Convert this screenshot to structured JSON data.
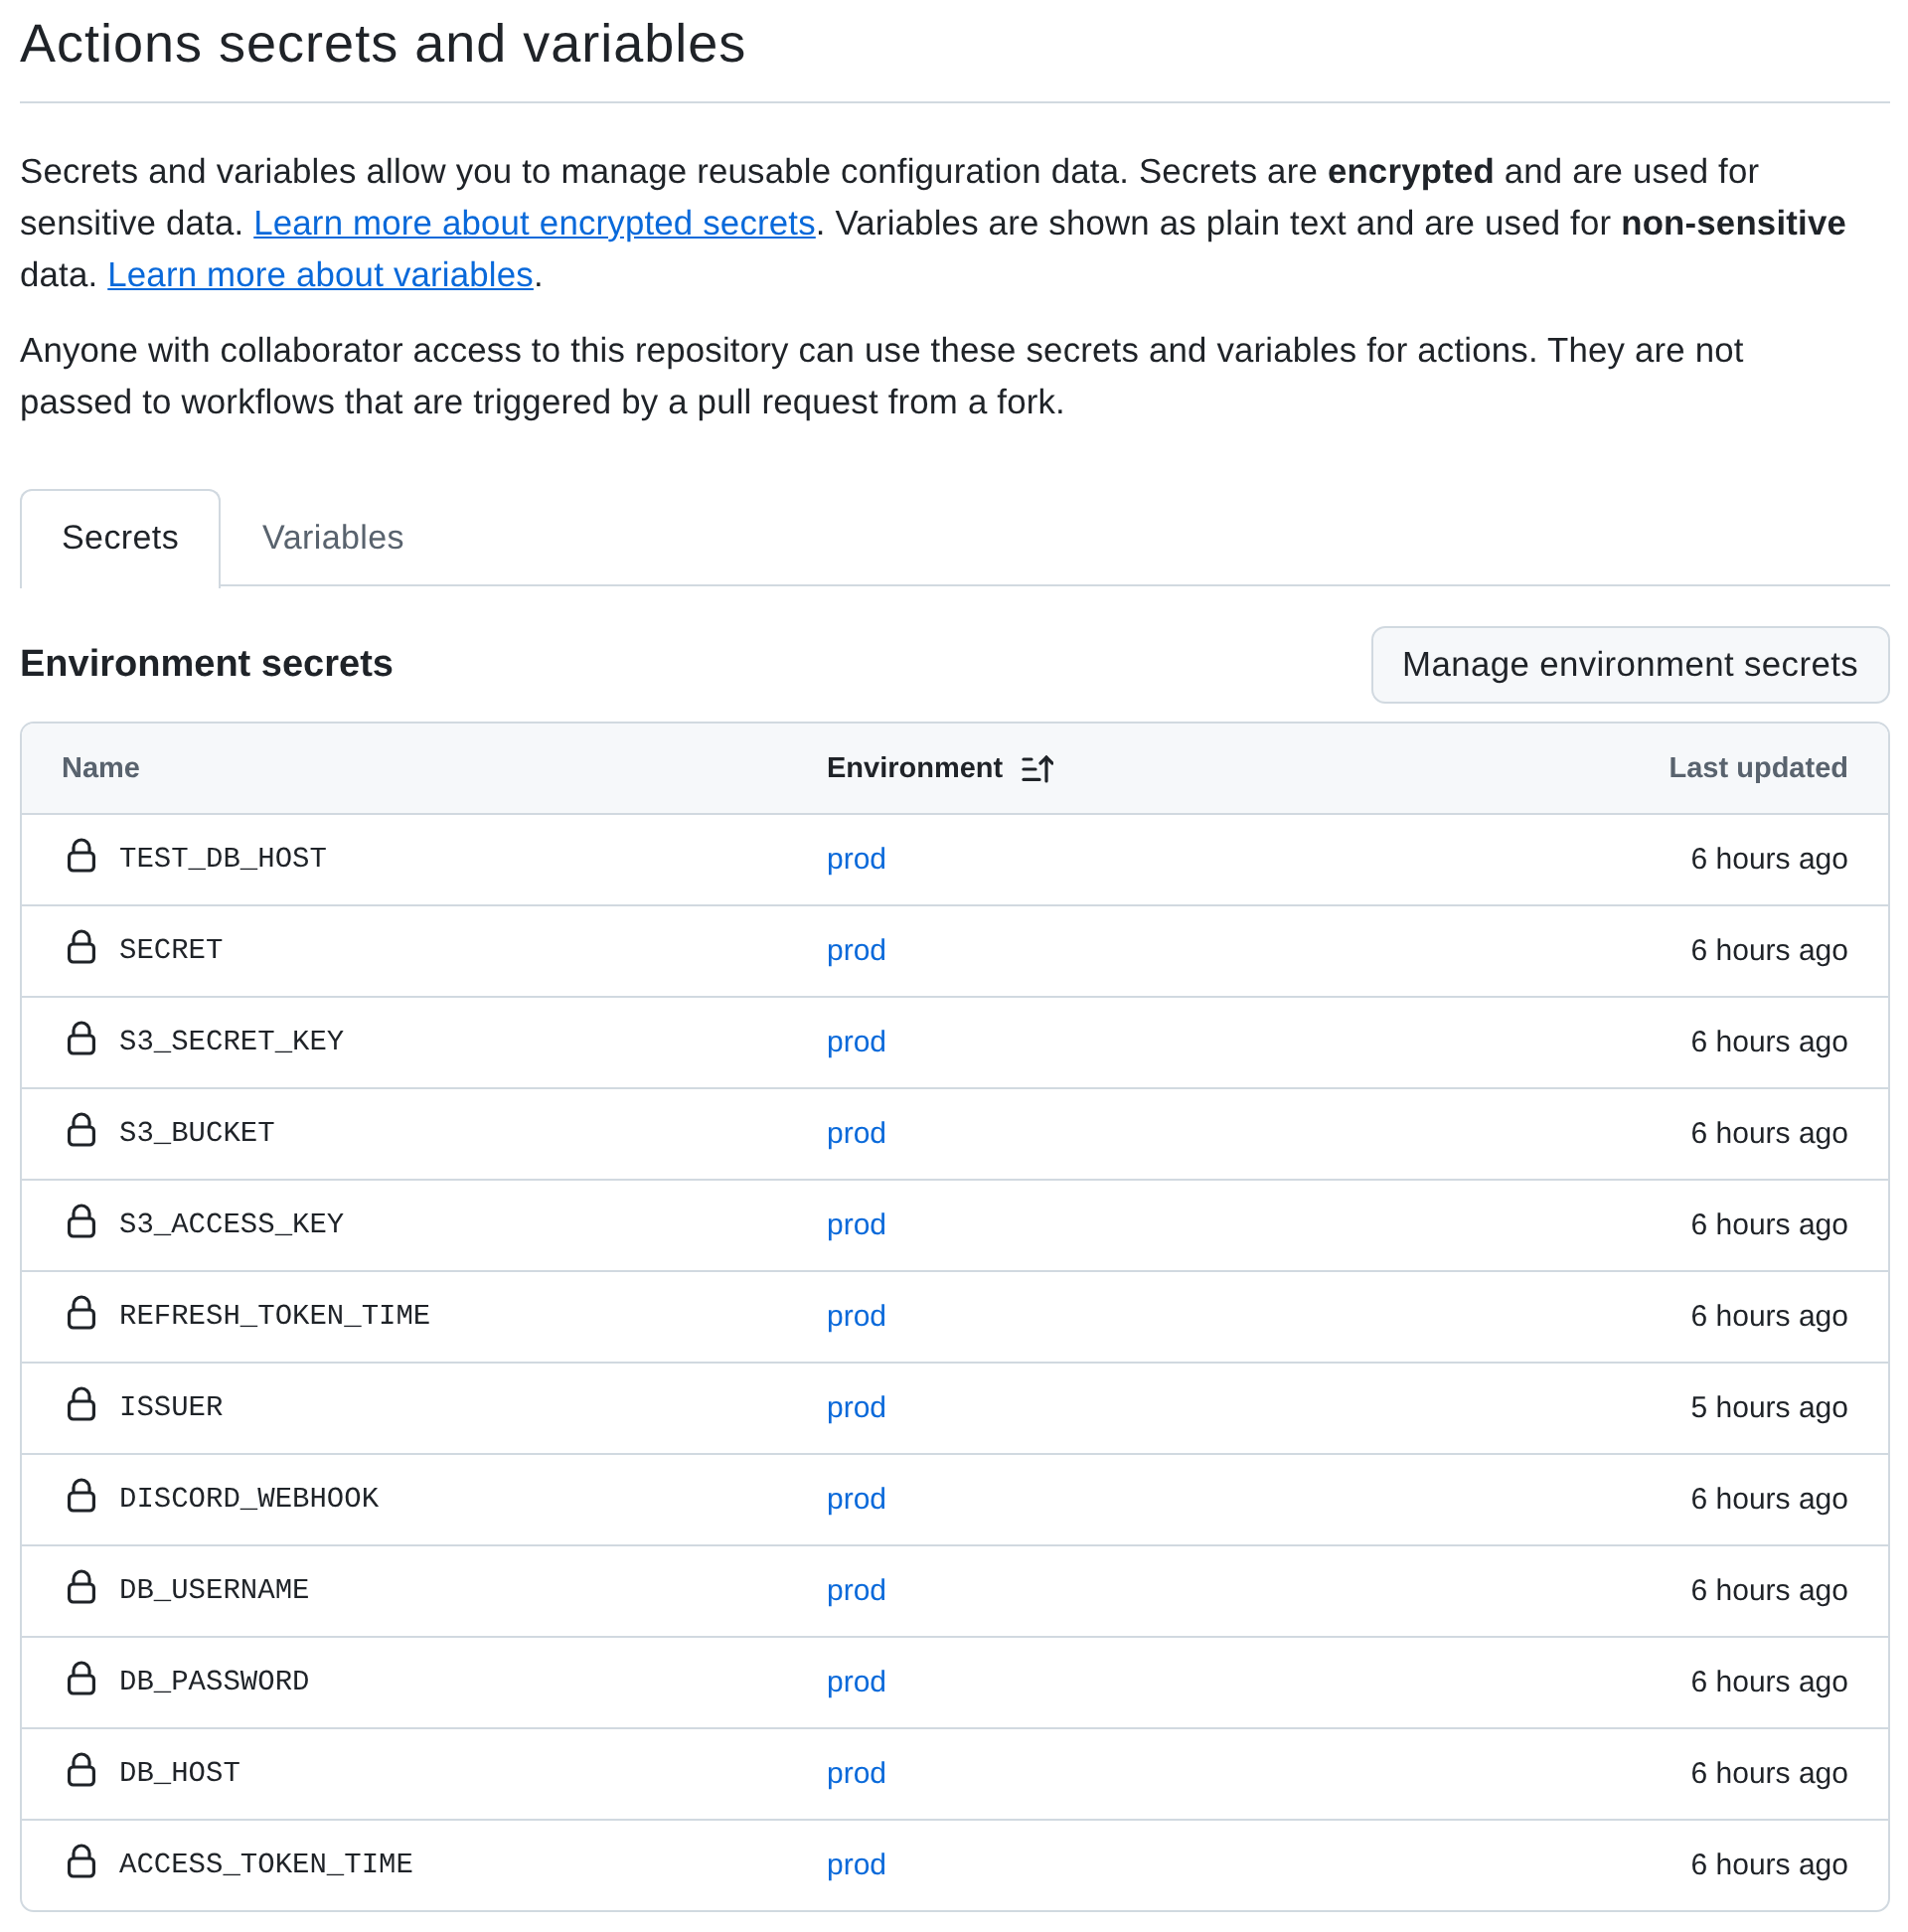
{
  "page": {
    "title": "Actions secrets and variables"
  },
  "description": [
    {
      "parts": [
        {
          "kind": "text",
          "text": "Secrets and variables allow you to manage reusable configuration data. Secrets are **encrypted** and are used for sensitive data. "
        },
        {
          "kind": "link",
          "text": "Learn more about encrypted secrets"
        },
        {
          "kind": "text",
          "text": ". Variables are shown as plain text and are used for **non-sensitive** data. "
        },
        {
          "kind": "link",
          "text": "Learn more about variables"
        },
        {
          "kind": "text",
          "text": "."
        }
      ]
    },
    {
      "parts": [
        {
          "kind": "text",
          "text": "Anyone with collaborator access to this repository can use these secrets and variables for actions. They are not passed to workflows that are triggered by a pull request from a fork."
        }
      ]
    }
  ],
  "tabs": [
    {
      "label": "Secrets",
      "selected": true
    },
    {
      "label": "Variables",
      "selected": false
    }
  ],
  "section": {
    "title": "Environment secrets",
    "button": "Manage environment secrets"
  },
  "table": {
    "columns": [
      {
        "label": "Name",
        "sorted": false
      },
      {
        "label": "Environment",
        "sorted": true
      },
      {
        "label": "Last updated",
        "sorted": false
      }
    ],
    "rows": [
      {
        "name": "TEST_DB_HOST",
        "environment": "prod",
        "updated": "6 hours ago"
      },
      {
        "name": "SECRET",
        "environment": "prod",
        "updated": "6 hours ago"
      },
      {
        "name": "S3_SECRET_KEY",
        "environment": "prod",
        "updated": "6 hours ago"
      },
      {
        "name": "S3_BUCKET",
        "environment": "prod",
        "updated": "6 hours ago"
      },
      {
        "name": "S3_ACCESS_KEY",
        "environment": "prod",
        "updated": "6 hours ago"
      },
      {
        "name": "REFRESH_TOKEN_TIME",
        "environment": "prod",
        "updated": "6 hours ago"
      },
      {
        "name": "ISSUER",
        "environment": "prod",
        "updated": "5 hours ago"
      },
      {
        "name": "DISCORD_WEBHOOK",
        "environment": "prod",
        "updated": "6 hours ago"
      },
      {
        "name": "DB_USERNAME",
        "environment": "prod",
        "updated": "6 hours ago"
      },
      {
        "name": "DB_PASSWORD",
        "environment": "prod",
        "updated": "6 hours ago"
      },
      {
        "name": "DB_HOST",
        "environment": "prod",
        "updated": "6 hours ago"
      },
      {
        "name": "ACCESS_TOKEN_TIME",
        "environment": "prod",
        "updated": "6 hours ago"
      }
    ]
  }
}
